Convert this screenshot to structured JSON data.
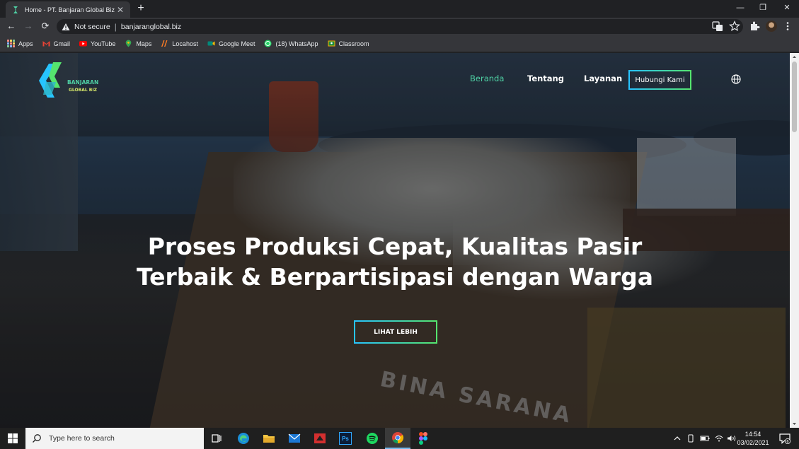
{
  "browser": {
    "tab": {
      "title": "Home - PT. Banjaran Global Biz",
      "close": "✕"
    },
    "new_tab": "+",
    "window_controls": {
      "minimize": "—",
      "maximize": "❐",
      "close": "✕"
    },
    "nav": {
      "back": "←",
      "forward": "→",
      "reload": "⟳"
    },
    "security_label": "Not secure",
    "separator": "|",
    "url": "banjaranglobal.biz",
    "icons": [
      "translate-icon",
      "star-icon",
      "extensions-icon",
      "menu-icon"
    ]
  },
  "bookmarks": [
    {
      "label": "Apps",
      "icon": "apps-icon",
      "color": "#f28b82"
    },
    {
      "label": "Gmail",
      "icon": "gmail-icon",
      "color": "#ea4335"
    },
    {
      "label": "YouTube",
      "icon": "youtube-icon",
      "color": "#ff0000"
    },
    {
      "label": "Maps",
      "icon": "maps-icon",
      "color": "#34a853"
    },
    {
      "label": "Locahost",
      "icon": "xampp-icon",
      "color": "#fb7a24"
    },
    {
      "label": "Google Meet",
      "icon": "meet-icon",
      "color": "#00897b"
    },
    {
      "label": "(18) WhatsApp",
      "icon": "whatsapp-icon",
      "color": "#25d366"
    },
    {
      "label": "Classroom",
      "icon": "classroom-icon",
      "color": "#f9ab00"
    }
  ],
  "site": {
    "logo": {
      "line1": "BANJARAN",
      "line2": "GLOBAL BIZ"
    },
    "nav": {
      "home": "Beranda",
      "about": "Tentang",
      "services": "Layanan",
      "contact": "Hubungi Kami"
    },
    "hero": {
      "headline_line1": "Proses Produksi Cepat, Kualitas Pasir",
      "headline_line2": "Terbaik & Berpartisipasi dengan Warga",
      "cta": "LIHAT LEBIH",
      "hull_text": "BINA SARANA"
    },
    "colors": {
      "accent_green": "#4fd1a5",
      "gradient_start": "#27c4ff",
      "gradient_end": "#55e56e"
    }
  },
  "taskbar": {
    "search_placeholder": "Type here to search",
    "apps": [
      "task-view-icon",
      "edge-icon",
      "file-explorer-icon",
      "mail-icon",
      "app-icon",
      "photoshop-icon",
      "spotify-icon",
      "chrome-icon",
      "figma-icon"
    ],
    "photoshop_label": "Ps",
    "clock": {
      "time": "14:54",
      "date": "03/02/2021"
    },
    "notification_count": "6"
  }
}
